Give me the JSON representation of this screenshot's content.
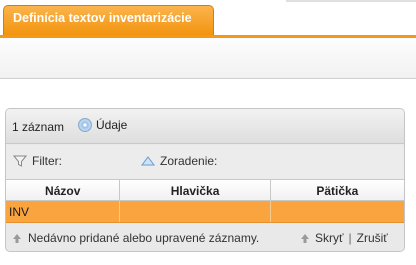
{
  "tabs": [
    {
      "label": "Definícia textov inventarizácie",
      "active": true
    }
  ],
  "panel": {
    "record_count": "1 záznam",
    "data_label": "Údaje",
    "filter_label": "Filter:",
    "sort_label": "Zoradenie:",
    "columns": [
      "Názov",
      "Hlavička",
      "Pätička"
    ],
    "rows": [
      [
        "INV",
        "",
        ""
      ]
    ],
    "recent_text": "Nedávno pridané alebo upravené záznamy.",
    "hide_label": "Skryť",
    "separator": "|",
    "cancel_label": "Zrušiť"
  },
  "colors": {
    "accent": "#f3981a",
    "row_selected": "#f9a43f"
  },
  "icons": [
    "disk-icon",
    "funnel-icon",
    "sort-triangle-icon",
    "arrow-up-icon"
  ]
}
